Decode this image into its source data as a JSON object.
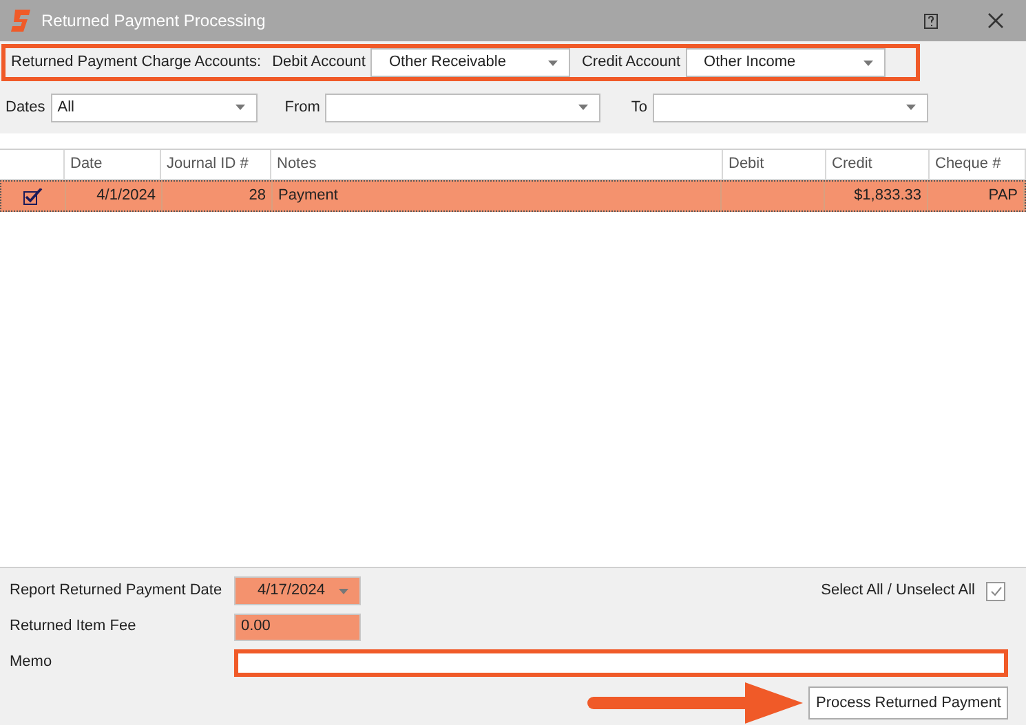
{
  "window": {
    "title": "Returned Payment Processing"
  },
  "accounts": {
    "label": "Returned Payment Charge Accounts:",
    "debit_label": "Debit Account",
    "debit_value": "Other Receivable",
    "credit_label": "Credit Account",
    "credit_value": "Other Income"
  },
  "filters": {
    "dates_label": "Dates",
    "dates_value": "All",
    "from_label": "From",
    "to_label": "To"
  },
  "table": {
    "columns": [
      "Date",
      "Journal ID #",
      "Notes",
      "Debit",
      "Credit",
      "Cheque #"
    ],
    "rows": [
      {
        "checked": true,
        "selected": true,
        "cells": [
          "4/1/2024",
          "28",
          "Payment",
          "",
          "$1,833.33",
          "PAP"
        ]
      }
    ]
  },
  "bottom": {
    "date_label": "Report Returned Payment Date",
    "date_value": "4/17/2024",
    "fee_label": "Returned Item Fee",
    "fee_value": "0.00",
    "memo_label": "Memo",
    "select_all_label": "Select All / Unselect All",
    "select_all_checked": true,
    "process_button": "Process Returned Payment"
  }
}
